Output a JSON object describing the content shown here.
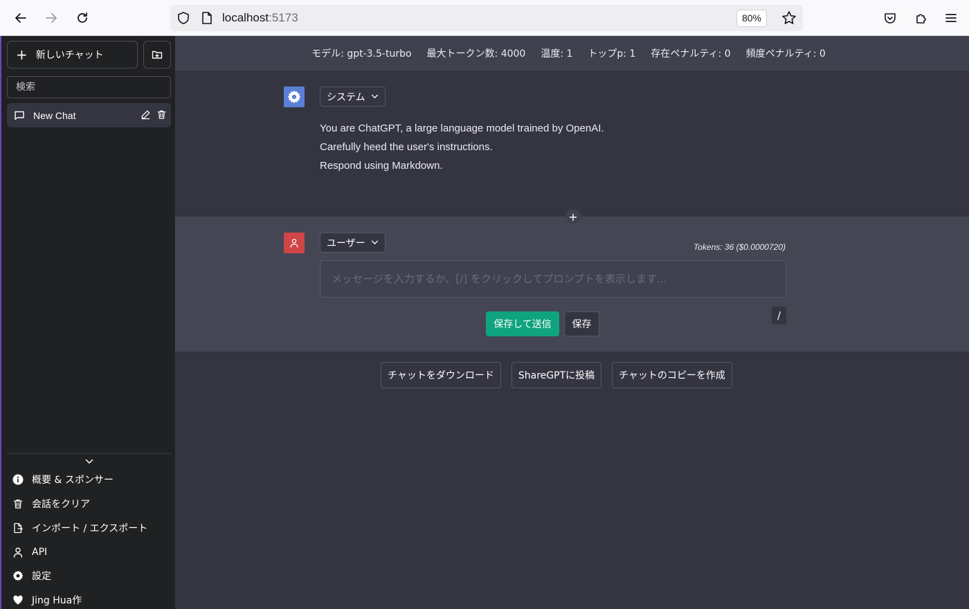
{
  "browser": {
    "url_host": "localhost",
    "url_port": ":5173",
    "zoom": "80%"
  },
  "sidebar": {
    "new_chat_label": "新しいチャット",
    "search_placeholder": "検索",
    "chats": [
      {
        "label": "New Chat"
      }
    ],
    "menu": [
      {
        "label": "概要 & スポンサー",
        "icon": "info-icon"
      },
      {
        "label": "会話をクリア",
        "icon": "trash-icon"
      },
      {
        "label": "インポート / エクスポート",
        "icon": "file-export-icon"
      },
      {
        "label": "API",
        "icon": "person-icon"
      },
      {
        "label": "設定",
        "icon": "gear-icon"
      },
      {
        "label": "Jing Hua作",
        "icon": "heart-icon"
      }
    ]
  },
  "config": {
    "model": "モデル: gpt-3.5-turbo",
    "max_tokens": "最大トークン数: 4000",
    "temperature": "温度: 1",
    "top_p": "トップp: 1",
    "presence_penalty": "存在ペナルティ: 0",
    "frequency_penalty": "頻度ペナルティ: 0"
  },
  "system_message": {
    "role": "システム",
    "lines": [
      "You are ChatGPT, a large language model trained by OpenAI.",
      "Carefully heed the user's instructions.",
      "Respond using Markdown."
    ]
  },
  "user_message": {
    "role": "ユーザー",
    "tokens": "Tokens: 36 ($0.0000720)",
    "placeholder": "メッセージを入力するか、[/] をクリックしてプロンプトを表示します...",
    "value": "",
    "save_submit_label": "保存して送信",
    "save_label": "保存",
    "slash_label": "/"
  },
  "bottom_actions": {
    "download": "チャットをダウンロード",
    "sharegpt": "ShareGPTに投稿",
    "copy": "チャットのコピーを作成"
  },
  "colors": {
    "accent_green": "#10a37f",
    "system_avatar": "#5a7fd6",
    "user_avatar": "#d04545",
    "sidebar_bg": "#202123",
    "main_bg": "#343541"
  }
}
